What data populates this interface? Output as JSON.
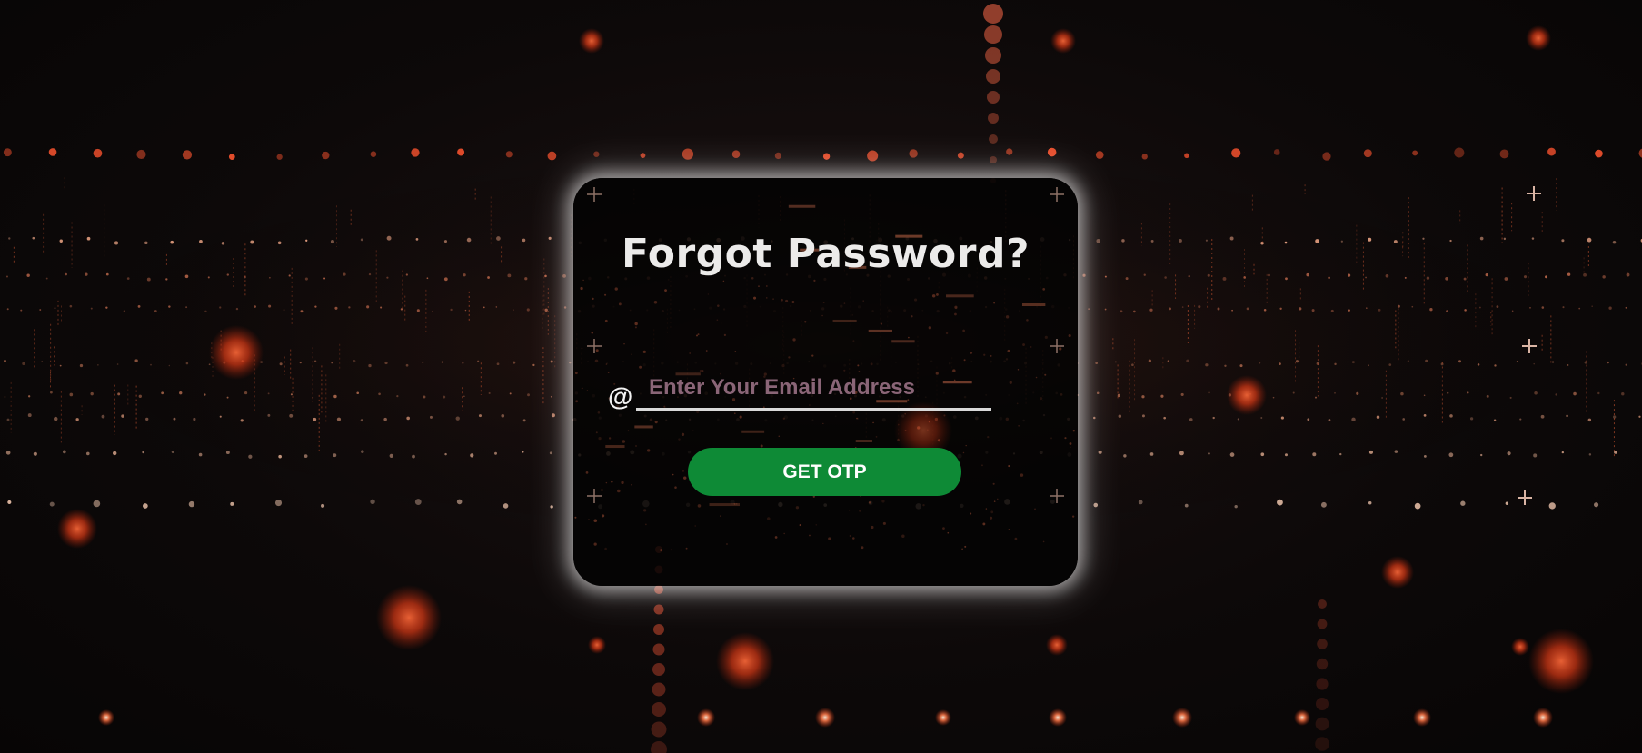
{
  "form": {
    "title": "Forgot Password?",
    "email_icon": "@",
    "email_placeholder": "Enter Your Email Address",
    "email_value": "",
    "submit_label": "GET OTP"
  },
  "colors": {
    "background": "#0b0808",
    "card": "#040303",
    "accent_glow": "#ff5a2e",
    "button": "#0e8a36",
    "placeholder": "#8a6577",
    "title": "#ecebea"
  }
}
